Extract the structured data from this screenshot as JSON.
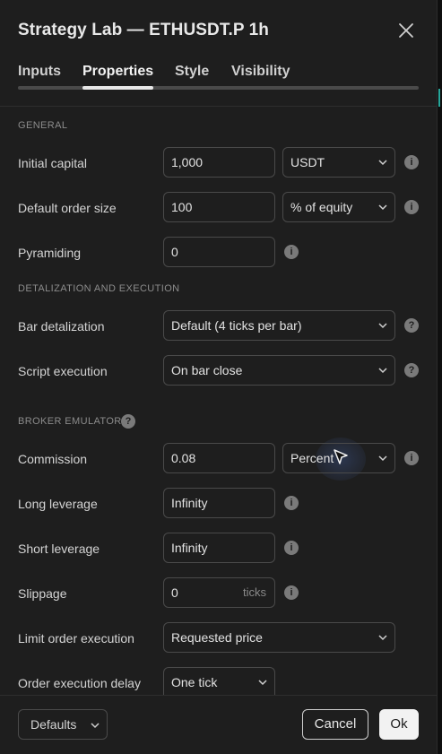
{
  "dialog": {
    "title": "Strategy Lab — ETHUSDT.P 1h",
    "tabs": [
      {
        "label": "Inputs",
        "active": false
      },
      {
        "label": "Properties",
        "active": true
      },
      {
        "label": "Style",
        "active": false
      },
      {
        "label": "Visibility",
        "active": false
      }
    ]
  },
  "sections": {
    "general": "GENERAL",
    "detalization": "DETALIZATION AND EXECUTION",
    "broker": "BROKER EMULATOR"
  },
  "fields": {
    "initial_capital": {
      "label": "Initial capital",
      "value": "1,000",
      "unit": "USDT"
    },
    "order_size": {
      "label": "Default order size",
      "value": "100",
      "unit": "% of equity"
    },
    "pyramiding": {
      "label": "Pyramiding",
      "value": "0"
    },
    "bar_detalization": {
      "label": "Bar detalization",
      "value": "Default (4 ticks per bar)"
    },
    "script_execution": {
      "label": "Script execution",
      "value": "On bar close"
    },
    "commission": {
      "label": "Commission",
      "value": "0.08",
      "unit": "Percent"
    },
    "long_leverage": {
      "label": "Long leverage",
      "value": "Infinity"
    },
    "short_leverage": {
      "label": "Short leverage",
      "value": "Infinity"
    },
    "slippage": {
      "label": "Slippage",
      "value": "0",
      "suffix": "ticks"
    },
    "limit_order": {
      "label": "Limit order execution",
      "value": "Requested price"
    },
    "delay": {
      "label": "Order execution delay",
      "value": "One tick"
    }
  },
  "footer": {
    "defaults": "Defaults",
    "cancel": "Cancel",
    "ok": "Ok"
  },
  "icons": {
    "info": "info-icon",
    "help": "question-icon",
    "close": "close-icon",
    "chevron": "chevron-down-icon"
  },
  "colors": {
    "background": "#1e1e1e",
    "border": "#4a4a4a",
    "text": "#d4d4d4",
    "section": "#8c8c8c",
    "ok_bg": "#f2f2f2"
  }
}
